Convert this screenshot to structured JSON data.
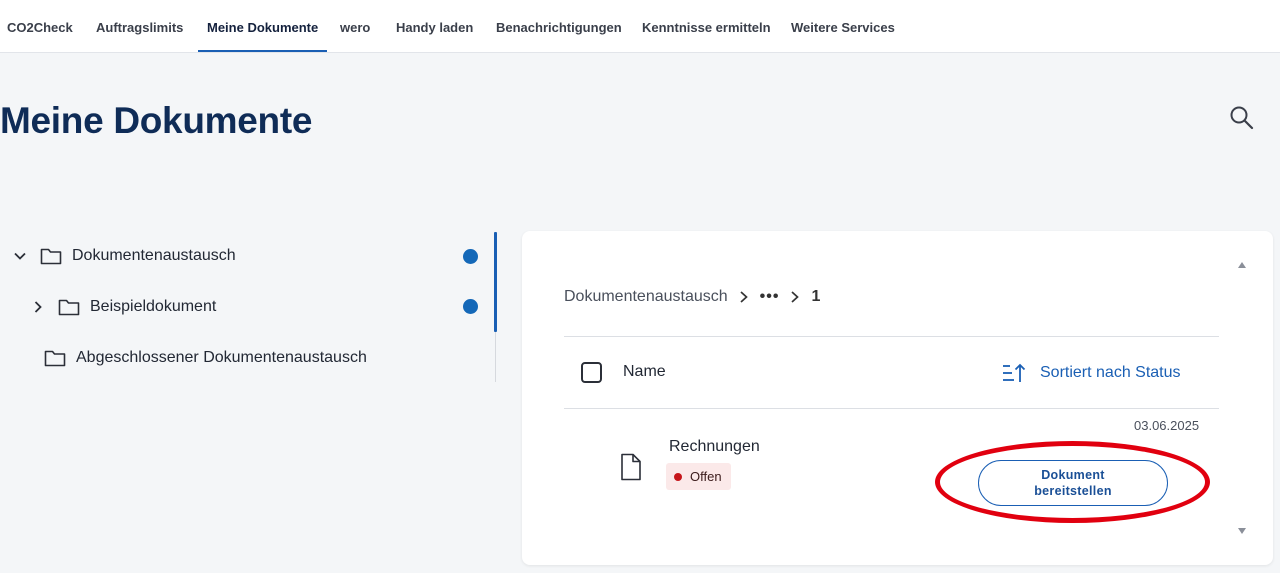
{
  "nav": {
    "tabs": [
      {
        "label": "CO2Check",
        "active": false
      },
      {
        "label": "Auftragslimits",
        "active": false
      },
      {
        "label": "Meine Dokumente",
        "active": true
      },
      {
        "label": "wero",
        "active": false
      },
      {
        "label": "Handy laden",
        "active": false
      },
      {
        "label": "Benachrichtigungen",
        "active": false
      },
      {
        "label": "Kenntnisse ermitteln",
        "active": false
      },
      {
        "label": "Weitere Services",
        "active": false
      }
    ]
  },
  "page": {
    "title": "Meine Dokumente",
    "search_icon": "search-icon"
  },
  "tree": {
    "items": [
      {
        "label": "Dokumentenaustausch",
        "expanded": true,
        "has_dot": true
      },
      {
        "label": "Beispieldokument",
        "expanded": false,
        "has_dot": true
      },
      {
        "label": "Abgeschlossener Dokumentenaustausch",
        "has_dot": false
      }
    ],
    "dot_color": "#1468b8"
  },
  "content": {
    "breadcrumb": {
      "root": "Dokumentenaustausch",
      "ellipsis": "•••",
      "current": "1"
    },
    "table": {
      "column_name": "Name",
      "sort_label": "Sortiert nach Status",
      "rows": [
        {
          "name": "Rechnungen",
          "date": "03.06.2025",
          "status": "Offen",
          "status_color": "#c6161b",
          "action_line1": "Dokument",
          "action_line2": "bereitstellen"
        }
      ]
    }
  },
  "colors": {
    "accent": "#1a5fb4",
    "title": "#0f2c57",
    "annotation": "#e1000f"
  }
}
